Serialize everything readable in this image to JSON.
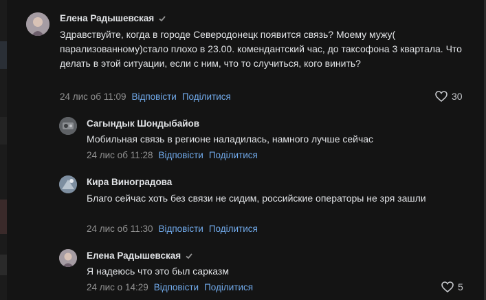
{
  "colors": {
    "background": "#141414",
    "text": "#e1e3e6",
    "muted": "#939393",
    "link": "#71aaeb"
  },
  "comments": [
    {
      "author": "Елена Радышевская",
      "verified": true,
      "text": "Здравствуйте, когда в городе Северодонецк появится связь? Моему мужу( парализованному)стало плохо в 23.00. комендантский час, до таксофона 3 квартала. Что делать в этой ситуации, если с ним, что то случиться, кого винить?",
      "date": "24 лис об 11:09",
      "reply": "Відповісти",
      "share": "Поділитися",
      "likes": "30"
    },
    {
      "author": "Сагындык Шондыбайов",
      "text": "Мобильная связь в регионе наладилась, намного лучше сейчас",
      "date": "24 лис об 11:28",
      "reply": "Відповісти",
      "share": "Поділитися"
    },
    {
      "author": "Кира Виноградова",
      "text": "Благо сейчас хоть без связи не сидим, российские операторы не зря зашли",
      "date": "24 лис об 11:30",
      "reply": "Відповісти",
      "share": "Поділитися"
    },
    {
      "author": "Елена Радышевская",
      "verified": true,
      "text": "Я надеюсь что это был сарказм",
      "date": "24 лис о 14:29",
      "reply": "Відповісти",
      "share": "Поділитися",
      "likes": "5"
    }
  ]
}
